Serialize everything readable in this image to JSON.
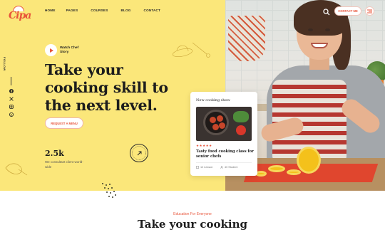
{
  "header": {
    "logo_text": "Cipa",
    "nav": [
      "HOME",
      "PAGES",
      "COURSES",
      "BLOG",
      "CONTACT"
    ],
    "contact_button": "CONTACT ME"
  },
  "sidebar": {
    "follow_label": "FOLLOW",
    "social_icons": [
      "facebook-icon",
      "x-icon",
      "instagram-icon",
      "pinterest-icon"
    ]
  },
  "hero": {
    "watch_label": "Watch Chef Story",
    "headline": "Take your cooking skill to the next level.",
    "cta": "REQUEST A MENU",
    "stat_value": "2.5k",
    "stat_caption": "We consultant client world-wide"
  },
  "card": {
    "title": "New cooking show",
    "rating_stars": "★★★★★",
    "rating": 5,
    "description": "Tasty food cooking class for senior chefs",
    "lessons": "12 Lesson",
    "students": "40 Student"
  },
  "section": {
    "kicker": "Education For Everyone",
    "title": "Take your cooking"
  },
  "colors": {
    "accent": "#e8543a",
    "hero_bg": "#fbe77a"
  }
}
